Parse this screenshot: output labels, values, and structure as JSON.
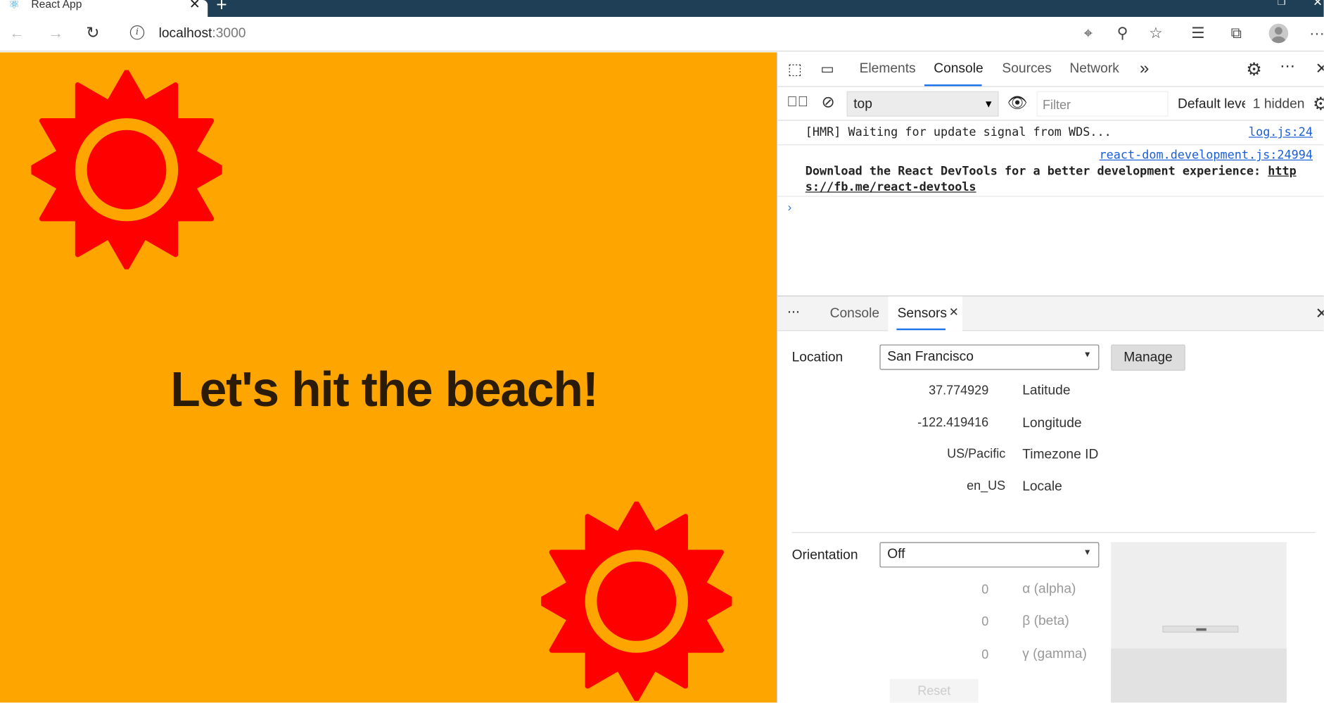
{
  "browser": {
    "tab_title": "React App",
    "url_host": "localhost",
    "url_port": ":3000",
    "icons": [
      "react-favicon",
      "close-icon",
      "plus-icon",
      "back-icon",
      "forward-icon",
      "reload-icon",
      "info-icon",
      "location-icon",
      "zoom-icon",
      "star-icon",
      "favorites-icon",
      "collections-icon",
      "profile-icon",
      "more-icon"
    ]
  },
  "page": {
    "headline": "Let's hit the beach!",
    "background": "#ffa500",
    "sun_color": "#ff0000"
  },
  "devtools": {
    "tabs": [
      "Elements",
      "Console",
      "Sources",
      "Network"
    ],
    "active_tab": "Console",
    "more_tabs": "»",
    "console_toolbar": {
      "context": "top",
      "filter_placeholder": "Filter",
      "levels": "Default levels",
      "hidden": "1 hidden"
    },
    "messages": [
      {
        "text": "[HMR] Waiting for update signal from WDS...",
        "source": "log.js:24"
      },
      {
        "source": "react-dom.development.js:24994",
        "text": "Download the React DevTools for a better development experience: ",
        "link1": "http",
        "link2": "s://fb.me/react-devtools"
      }
    ],
    "prompt": "›",
    "drawer": {
      "menu": "⋮",
      "tabs": [
        "Console",
        "Sensors"
      ],
      "active_tab": "Sensors"
    },
    "sensors": {
      "location_label": "Location",
      "location_value": "San Francisco",
      "manage_label": "Manage",
      "fields": [
        {
          "value": "37.774929",
          "label": "Latitude"
        },
        {
          "value": "-122.419416",
          "label": "Longitude"
        },
        {
          "value": "US/Pacific",
          "label": "Timezone ID"
        },
        {
          "value": "en_US",
          "label": "Locale"
        }
      ],
      "orientation_label": "Orientation",
      "orientation_value": "Off",
      "orientation_fields": [
        {
          "value": "0",
          "label": "α (alpha)"
        },
        {
          "value": "0",
          "label": "β (beta)"
        },
        {
          "value": "0",
          "label": "γ (gamma)"
        }
      ],
      "reset_label": "Reset"
    },
    "accent": "#1a73e8"
  }
}
